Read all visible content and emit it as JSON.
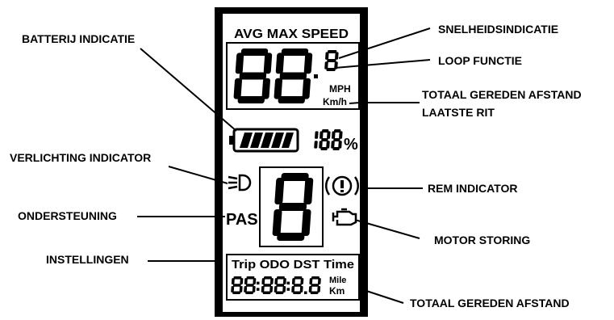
{
  "labels": {
    "snelheid": "SNELHEIDSINDICATIE",
    "loop": "LOOP FUNCTIE",
    "totaal_rit_line1": "TOTAAL GEREDEN AFSTAND",
    "totaal_rit_line2": "LAATSTE RIT",
    "batterij": "BATTERIJ INDICATIE",
    "verlichting": "VERLICHTING INDICATOR",
    "ondersteuning": "ONDERSTEUNING",
    "instellingen": "INSTELLINGEN",
    "rem": "REM INDICATOR",
    "motor": "MOTOR STORING",
    "totaal": "TOTAAL GEREDEN AFSTAND"
  },
  "display": {
    "header": "AVG MAX SPEED",
    "speed_digits": "88",
    "decimal_digit": "8",
    "unit_mph": "MPH",
    "unit_kmh": "Km/h",
    "battery_percent": "188",
    "percent_sign": "%",
    "pas_level": "8",
    "pas_label": "PAS",
    "modes": "Trip ODO DST Time",
    "odometer": "88:88:8.8",
    "unit_mile": "Mile",
    "unit_km": "Km"
  },
  "icons": [
    "headlight-icon",
    "brake-warning-icon",
    "engine-fault-icon",
    "battery-icon"
  ]
}
